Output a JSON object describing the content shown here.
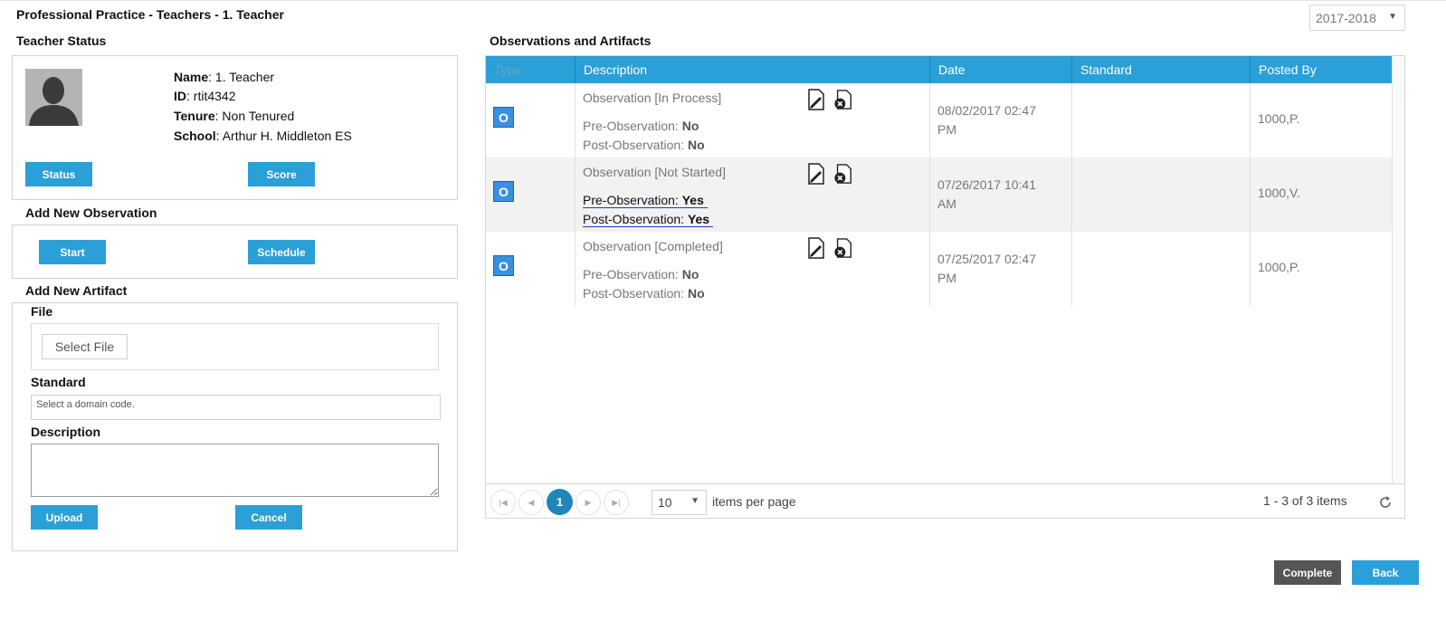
{
  "page": {
    "title": "Professional Practice - Teachers - 1. Teacher",
    "year_selected": "2017-2018"
  },
  "teacher_status": {
    "heading": "Teacher Status",
    "name_label": "Name",
    "name_value": "1. Teacher",
    "id_label": "ID",
    "id_value": "rtit4342",
    "tenure_label": "Tenure",
    "tenure_value": "Non Tenured",
    "school_label": "School",
    "school_value": "Arthur H. Middleton ES",
    "status_button": "Status",
    "score_button": "Score"
  },
  "add_observation": {
    "heading": "Add New Observation",
    "start_button": "Start",
    "schedule_button": "Schedule"
  },
  "add_artifact": {
    "heading": "Add New Artifact",
    "file_label": "File",
    "select_file_button": "Select File",
    "standard_label": "Standard",
    "standard_placeholder": "Select a domain code.",
    "description_label": "Description",
    "description_value": "",
    "upload_button": "Upload",
    "cancel_button": "Cancel"
  },
  "observations": {
    "heading": "Observations and Artifacts",
    "columns": [
      "Type",
      "Description",
      "Date",
      "Standard",
      "Posted By"
    ],
    "rows": [
      {
        "type_icon": "observation-icon",
        "title": "Observation [In Process]",
        "pre_label": "Pre-Observation:",
        "pre_value": "No",
        "post_label": "Post-Observation:",
        "post_value": "No",
        "date_line1": "08/02/2017 02:47",
        "date_line2": "PM",
        "standard": "",
        "posted_by": "1000,P."
      },
      {
        "type_icon": "observation-icon",
        "title": "Observation [Not Started]",
        "pre_label": "Pre-Observation:",
        "pre_value": "Yes",
        "post_label": "Post-Observation:",
        "post_value": "Yes",
        "date_line1": "07/26/2017 10:41",
        "date_line2": "AM",
        "standard": "",
        "posted_by": "1000,V."
      },
      {
        "type_icon": "observation-icon",
        "title": "Observation [Completed]",
        "pre_label": "Pre-Observation:",
        "pre_value": "No",
        "post_label": "Post-Observation:",
        "post_value": "No",
        "date_line1": "07/25/2017 02:47",
        "date_line2": "PM",
        "standard": "",
        "posted_by": "1000,P."
      }
    ],
    "pager": {
      "current_page": "1",
      "page_size": "10",
      "items_per_page_label": "items per page",
      "summary": "1 - 3 of 3 items"
    }
  },
  "footer": {
    "complete_button": "Complete",
    "back_button": "Back"
  },
  "colors": {
    "accent": "#2a9fd8",
    "header_border": "#1f86b8",
    "dark_button": "#555555"
  }
}
